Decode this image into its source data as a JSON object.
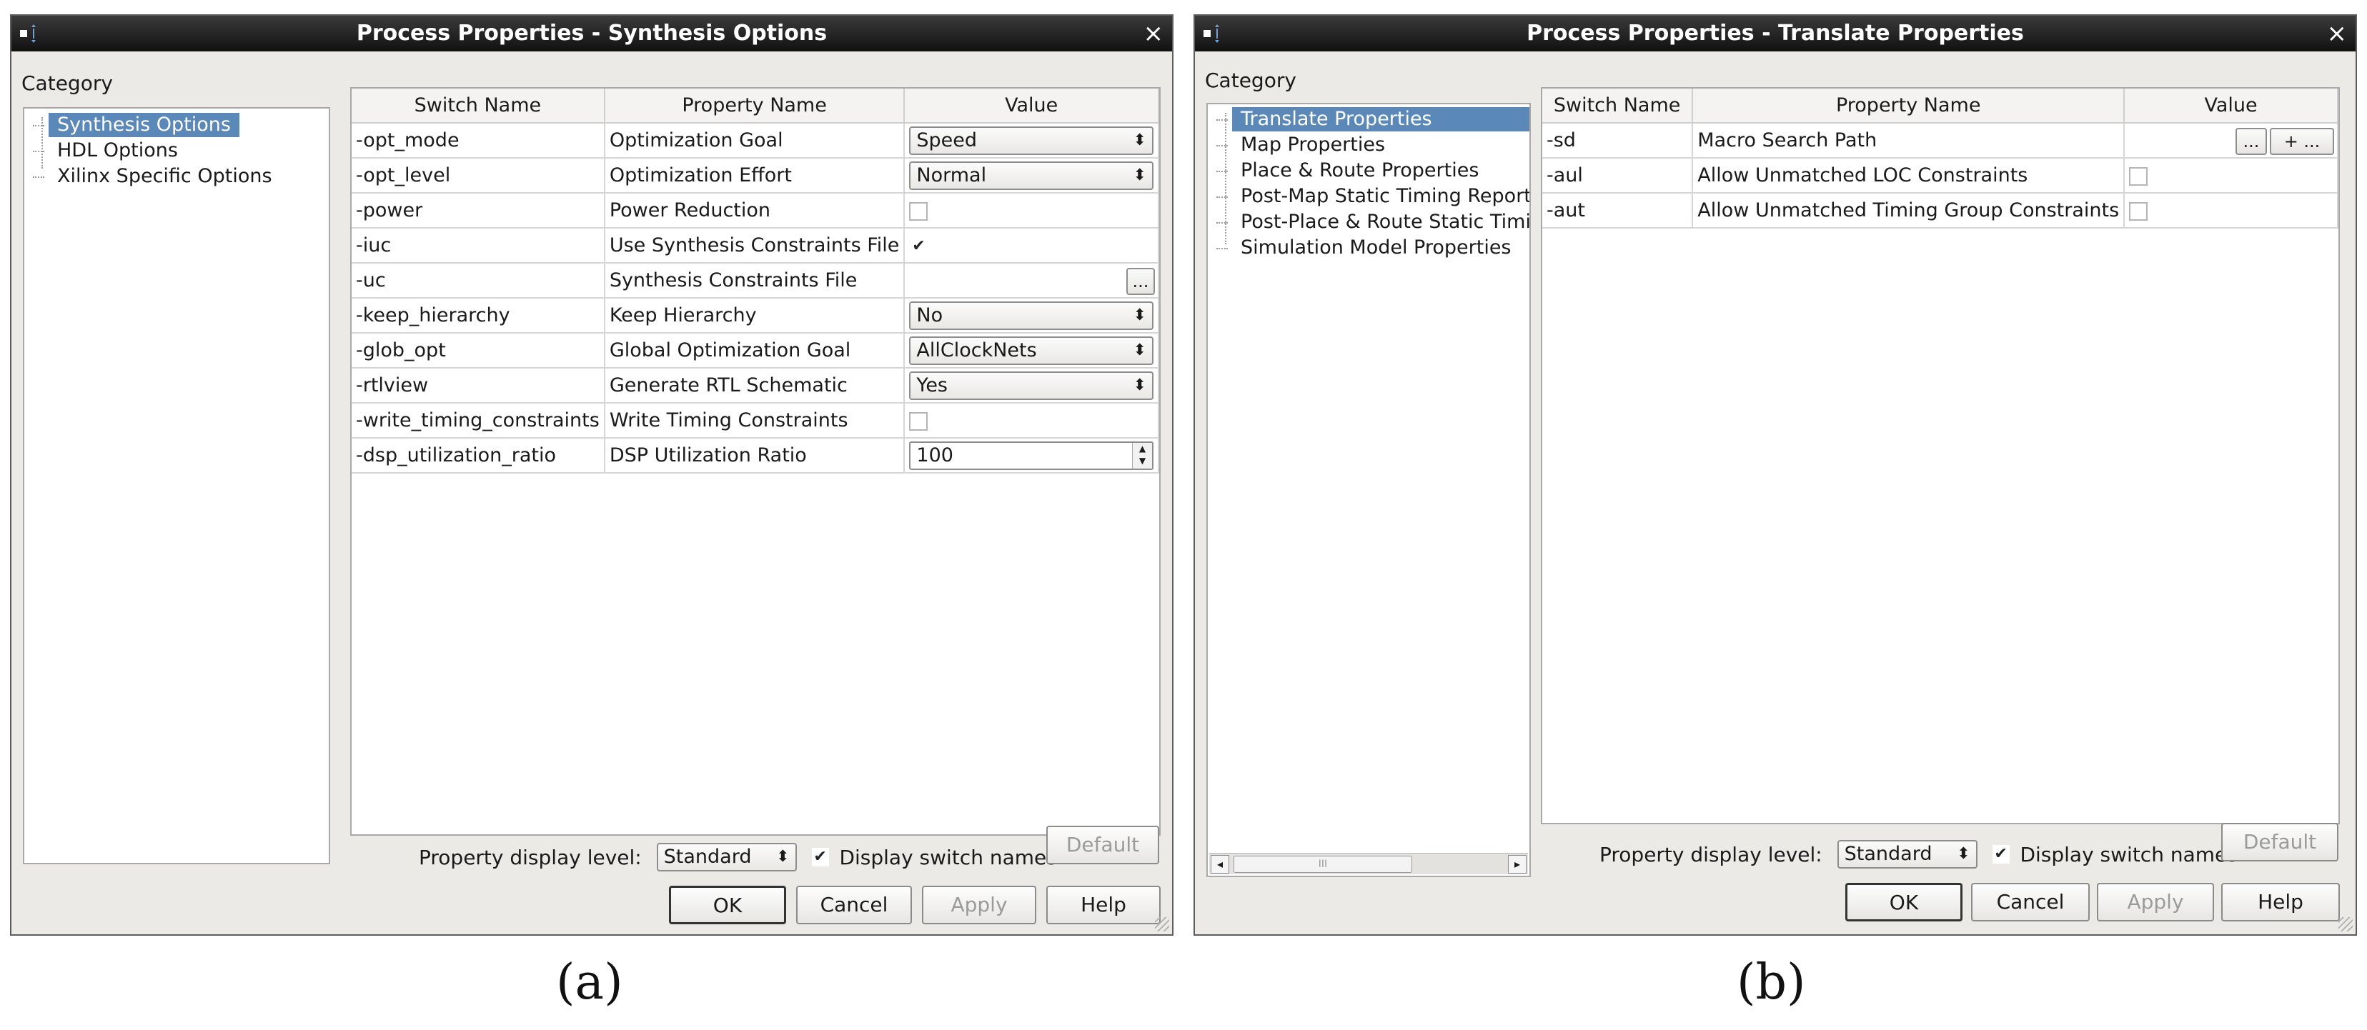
{
  "dialog_a": {
    "title": "Process Properties - Synthesis Options",
    "close_glyph": "×",
    "category_label": "Category",
    "categories": [
      "Synthesis Options",
      "HDL Options",
      "Xilinx Specific Options"
    ],
    "selected_category": "Synthesis Options",
    "columns": [
      "Switch Name",
      "Property Name",
      "Value"
    ],
    "rows": [
      {
        "switch": "-opt_mode",
        "property": "Optimization Goal",
        "value": "Speed",
        "kind": "combo"
      },
      {
        "switch": "-opt_level",
        "property": "Optimization Effort",
        "value": "Normal",
        "kind": "combo"
      },
      {
        "switch": "-power",
        "property": "Power Reduction",
        "value": "",
        "kind": "checkbox",
        "checked": false
      },
      {
        "switch": "-iuc",
        "property": "Use Synthesis Constraints File",
        "value": "✔",
        "kind": "checkbox",
        "checked": true
      },
      {
        "switch": "-uc",
        "property": "Synthesis Constraints File",
        "value": "...",
        "kind": "browse"
      },
      {
        "switch": "-keep_hierarchy",
        "property": "Keep Hierarchy",
        "value": "No",
        "kind": "combo"
      },
      {
        "switch": "-glob_opt",
        "property": "Global Optimization Goal",
        "value": "AllClockNets",
        "kind": "combo"
      },
      {
        "switch": "-rtlview",
        "property": "Generate RTL Schematic",
        "value": "Yes",
        "kind": "combo"
      },
      {
        "switch": "-write_timing_constraints",
        "property": "Write Timing Constraints",
        "value": "",
        "kind": "checkbox",
        "checked": false
      },
      {
        "switch": "-dsp_utilization_ratio",
        "property": "DSP Utilization Ratio",
        "value": "100",
        "kind": "spin"
      }
    ],
    "display_level_label": "Property display level:",
    "display_level_value": "Standard",
    "display_switch_label": "Display switch names",
    "display_switch_checked": "✔",
    "default_label": "Default",
    "buttons": {
      "ok": "OK",
      "cancel": "Cancel",
      "apply": "Apply",
      "help": "Help"
    }
  },
  "dialog_b": {
    "title": "Process Properties - Translate Properties",
    "close_glyph": "×",
    "category_label": "Category",
    "categories": [
      "Translate Properties",
      "Map Properties",
      "Place & Route Properties",
      "Post-Map Static Timing Report",
      "Post-Place & Route Static Timi",
      "Simulation Model Properties"
    ],
    "selected_category": "Translate Properties",
    "columns": [
      "Switch Name",
      "Property Name",
      "Value"
    ],
    "rows": [
      {
        "switch": "-sd",
        "property": "Macro Search Path",
        "value": "...",
        "extra": "+ ...",
        "kind": "browse2"
      },
      {
        "switch": "-aul",
        "property": "Allow Unmatched LOC Constraints",
        "value": "",
        "kind": "checkbox",
        "checked": false
      },
      {
        "switch": "-aut",
        "property": "Allow Unmatched Timing Group Constraints",
        "value": "",
        "kind": "checkbox",
        "checked": false
      }
    ],
    "scroll_thumb": "III",
    "scroll_left": "◂",
    "scroll_right": "▸",
    "display_level_label": "Property display level:",
    "display_level_value": "Standard",
    "display_switch_label": "Display switch names",
    "display_switch_checked": "✔",
    "default_label": "Default",
    "buttons": {
      "ok": "OK",
      "cancel": "Cancel",
      "apply": "Apply",
      "help": "Help"
    }
  },
  "captions": {
    "a": "(a)",
    "b": "(b)"
  },
  "combo_arrows": "⬍"
}
